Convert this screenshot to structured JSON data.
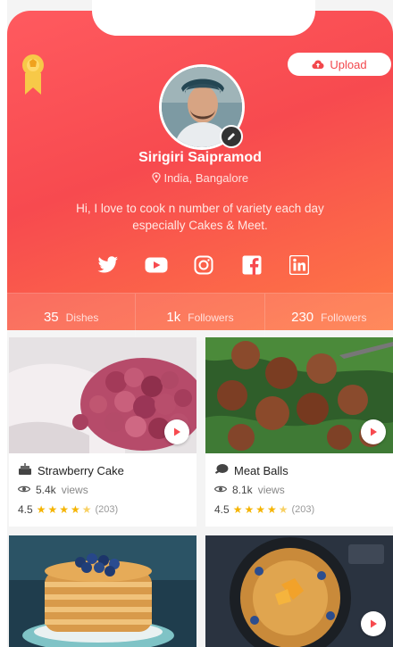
{
  "header": {
    "upload_label": "Upload"
  },
  "profile": {
    "name": "Sirigiri Saipramod",
    "location": "India, Bangalore",
    "bio": "Hi, I love to cook n number of variety each day especially Cakes & Meet."
  },
  "socials": [
    "twitter-icon",
    "youtube-icon",
    "instagram-icon",
    "facebook-icon",
    "linkedin-icon"
  ],
  "stats": [
    {
      "value": "35",
      "label": "Dishes"
    },
    {
      "value": "1k",
      "label": "Followers"
    },
    {
      "value": "230",
      "label": "Followers"
    }
  ],
  "dishes": [
    {
      "title": "Strawberry Cake",
      "views": "5.4k",
      "views_label": "views",
      "rating": "4.5",
      "stars": 4.5,
      "reviews": "(203)"
    },
    {
      "title": "Meat Balls",
      "views": "8.1k",
      "views_label": "views",
      "rating": "4.5",
      "stars": 4.5,
      "reviews": "(203)"
    },
    {
      "title": "",
      "views": "",
      "rating": "",
      "reviews": ""
    },
    {
      "title": "",
      "views": "",
      "rating": "",
      "reviews": ""
    }
  ],
  "colors": {
    "accent": "#f74a4f",
    "gradient_end": "#ff7a45",
    "star": "#f5b400"
  }
}
